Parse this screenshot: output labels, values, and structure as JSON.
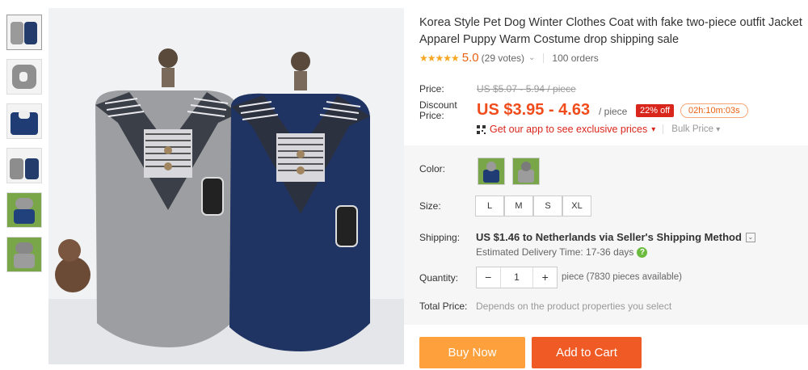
{
  "product": {
    "title": "Korea Style Pet Dog Winter Clothes Coat with fake two-piece outfit Jacket Apparel Puppy Warm Costume drop shipping sale"
  },
  "rating": {
    "stars": "★★★★★",
    "score": "5.0",
    "votes": "(29 votes)",
    "dropdown_icon": "chevron-down-icon",
    "orders": "100 orders"
  },
  "price": {
    "label": "Price:",
    "original": "US $5.07 - 5.94 / piece",
    "discount_label_1": "Discount",
    "discount_label_2": "Price:",
    "current": "US $3.95 - 4.63",
    "unit": "/ piece",
    "discount_badge": "22% off",
    "timer": "02h:10m:03s",
    "app_promo": "Get our app to see exclusive prices",
    "app_promo_caret": "▾",
    "bulk": "Bulk Price",
    "bulk_caret": "▾"
  },
  "options": {
    "color_label": "Color:",
    "colors": [
      "blue",
      "gray"
    ],
    "size_label": "Size:",
    "sizes": [
      "L",
      "M",
      "S",
      "XL"
    ]
  },
  "shipping": {
    "label": "Shipping:",
    "value": "US $1.46 to Netherlands via Seller's Shipping Method",
    "dropdown": "⌄",
    "estimate": "Estimated Delivery Time: 17-36 days",
    "help": "?"
  },
  "quantity": {
    "label": "Quantity:",
    "minus": "−",
    "value": "1",
    "plus": "+",
    "available": "piece (7830 pieces available)"
  },
  "total": {
    "label": "Total Price:",
    "value": "Depends on the product properties you select"
  },
  "actions": {
    "buy_now": "Buy Now",
    "add_to_cart": "Add to Cart"
  },
  "colors": {
    "accent": "#f04c1c",
    "buy_now_bg": "#fea03b",
    "cart_bg": "#f05a25",
    "star": "#f5a623"
  }
}
